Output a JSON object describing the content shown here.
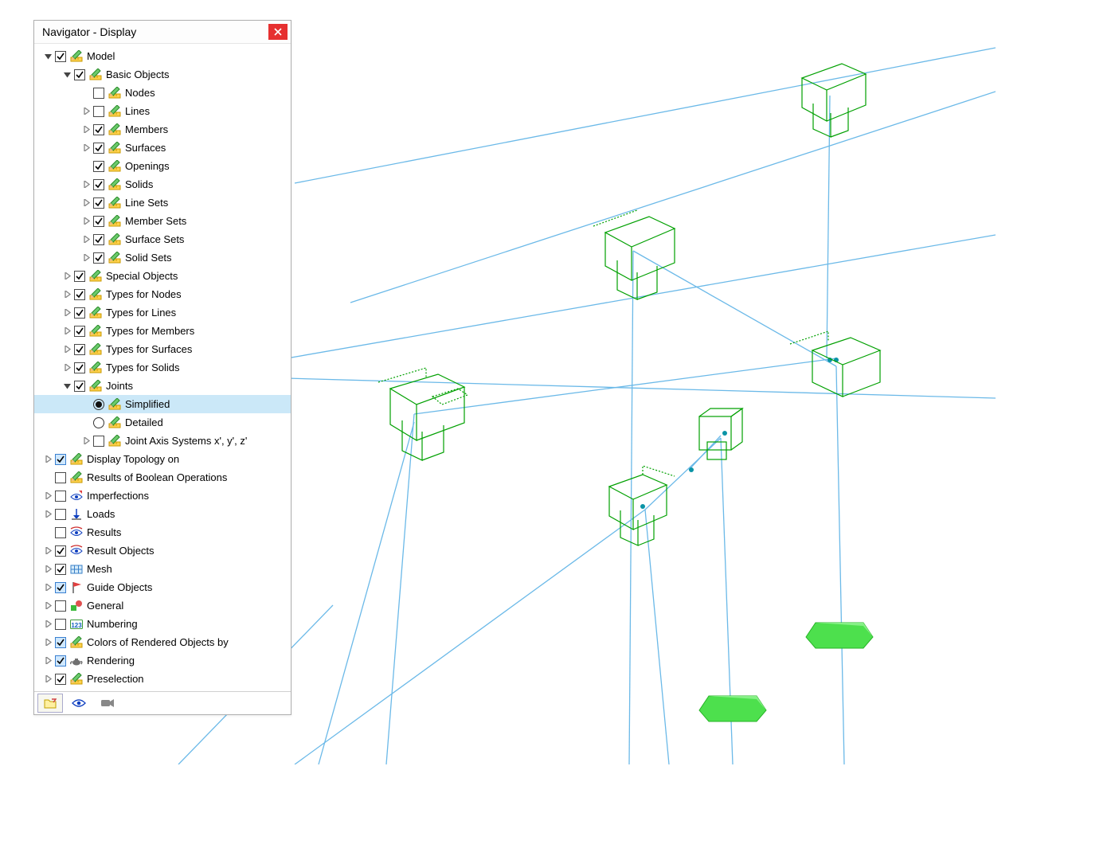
{
  "panel": {
    "title": "Navigator - Display"
  },
  "tree": [
    {
      "id": "model",
      "indent": 0,
      "expander": "down",
      "check": true,
      "icon": "pencil-ruler",
      "label": "Model"
    },
    {
      "id": "basic-objects",
      "indent": 1,
      "expander": "down",
      "check": true,
      "icon": "pencil-ruler",
      "label": "Basic Objects"
    },
    {
      "id": "nodes",
      "indent": 2,
      "expander": "none",
      "check": false,
      "icon": "pencil-ruler",
      "label": "Nodes"
    },
    {
      "id": "lines",
      "indent": 2,
      "expander": "right",
      "check": false,
      "icon": "pencil-ruler",
      "label": "Lines"
    },
    {
      "id": "members",
      "indent": 2,
      "expander": "right",
      "check": true,
      "icon": "pencil-ruler",
      "label": "Members"
    },
    {
      "id": "surfaces",
      "indent": 2,
      "expander": "right",
      "check": true,
      "icon": "pencil-ruler",
      "label": "Surfaces"
    },
    {
      "id": "openings",
      "indent": 2,
      "expander": "none",
      "check": true,
      "icon": "pencil-ruler",
      "label": "Openings"
    },
    {
      "id": "solids",
      "indent": 2,
      "expander": "right",
      "check": true,
      "icon": "pencil-ruler",
      "label": "Solids"
    },
    {
      "id": "line-sets",
      "indent": 2,
      "expander": "right",
      "check": true,
      "icon": "pencil-ruler",
      "label": "Line Sets"
    },
    {
      "id": "member-sets",
      "indent": 2,
      "expander": "right",
      "check": true,
      "icon": "pencil-ruler",
      "label": "Member Sets"
    },
    {
      "id": "surface-sets",
      "indent": 2,
      "expander": "right",
      "check": true,
      "icon": "pencil-ruler",
      "label": "Surface Sets"
    },
    {
      "id": "solid-sets",
      "indent": 2,
      "expander": "right",
      "check": true,
      "icon": "pencil-ruler",
      "label": "Solid Sets"
    },
    {
      "id": "special-objects",
      "indent": 1,
      "expander": "right",
      "check": true,
      "icon": "pencil-ruler",
      "label": "Special Objects"
    },
    {
      "id": "types-nodes",
      "indent": 1,
      "expander": "right",
      "check": true,
      "icon": "pencil-ruler",
      "label": "Types for Nodes"
    },
    {
      "id": "types-lines",
      "indent": 1,
      "expander": "right",
      "check": true,
      "icon": "pencil-ruler",
      "label": "Types for Lines"
    },
    {
      "id": "types-members",
      "indent": 1,
      "expander": "right",
      "check": true,
      "icon": "pencil-ruler",
      "label": "Types for Members"
    },
    {
      "id": "types-surfaces",
      "indent": 1,
      "expander": "right",
      "check": true,
      "icon": "pencil-ruler",
      "label": "Types for Surfaces"
    },
    {
      "id": "types-solids",
      "indent": 1,
      "expander": "right",
      "check": true,
      "icon": "pencil-ruler",
      "label": "Types for Solids"
    },
    {
      "id": "joints",
      "indent": 1,
      "expander": "down",
      "check": true,
      "icon": "pencil-ruler",
      "label": "Joints"
    },
    {
      "id": "simplified",
      "indent": 2,
      "expander": "none",
      "control": "radio",
      "radio": true,
      "icon": "pencil-ruler",
      "label": "Simplified",
      "selected": true
    },
    {
      "id": "detailed",
      "indent": 2,
      "expander": "none",
      "control": "radio",
      "radio": false,
      "icon": "pencil-ruler",
      "label": "Detailed"
    },
    {
      "id": "joint-axis",
      "indent": 2,
      "expander": "right",
      "check": false,
      "icon": "pencil-ruler",
      "label": "Joint Axis Systems x', y', z'"
    },
    {
      "id": "display-topology",
      "indent": 0,
      "expander": "right",
      "checkStyle": "blue",
      "check": true,
      "icon": "pencil-ruler",
      "label": "Display Topology on"
    },
    {
      "id": "boolean",
      "indent": 0,
      "expander": "none",
      "check": false,
      "icon": "pencil-ruler",
      "label": "Results of Boolean Operations"
    },
    {
      "id": "imperfections",
      "indent": 0,
      "expander": "right",
      "check": false,
      "icon": "eye-flag",
      "label": "Imperfections"
    },
    {
      "id": "loads",
      "indent": 0,
      "expander": "right",
      "check": false,
      "icon": "load-arrow",
      "label": "Loads"
    },
    {
      "id": "results",
      "indent": 0,
      "expander": "none",
      "check": false,
      "icon": "eye-swoosh",
      "label": "Results"
    },
    {
      "id": "result-objects",
      "indent": 0,
      "expander": "right",
      "check": true,
      "icon": "eye-swoosh",
      "label": "Result Objects"
    },
    {
      "id": "mesh",
      "indent": 0,
      "expander": "right",
      "check": true,
      "icon": "mesh-grid",
      "label": "Mesh"
    },
    {
      "id": "guide-objects",
      "indent": 0,
      "expander": "right",
      "checkStyle": "blue",
      "check": true,
      "icon": "guide-flag",
      "label": "Guide Objects"
    },
    {
      "id": "general",
      "indent": 0,
      "expander": "right",
      "check": false,
      "icon": "shapes",
      "label": "General"
    },
    {
      "id": "numbering",
      "indent": 0,
      "expander": "right",
      "check": false,
      "icon": "numbering",
      "label": "Numbering"
    },
    {
      "id": "colors",
      "indent": 0,
      "expander": "right",
      "checkStyle": "blue",
      "check": true,
      "icon": "pencil-ruler",
      "label": "Colors of Rendered Objects by"
    },
    {
      "id": "rendering",
      "indent": 0,
      "expander": "right",
      "checkStyle": "blue",
      "check": true,
      "icon": "teapot",
      "label": "Rendering"
    },
    {
      "id": "preselection",
      "indent": 0,
      "expander": "right",
      "check": true,
      "icon": "pencil-ruler",
      "label": "Preselection"
    }
  ]
}
